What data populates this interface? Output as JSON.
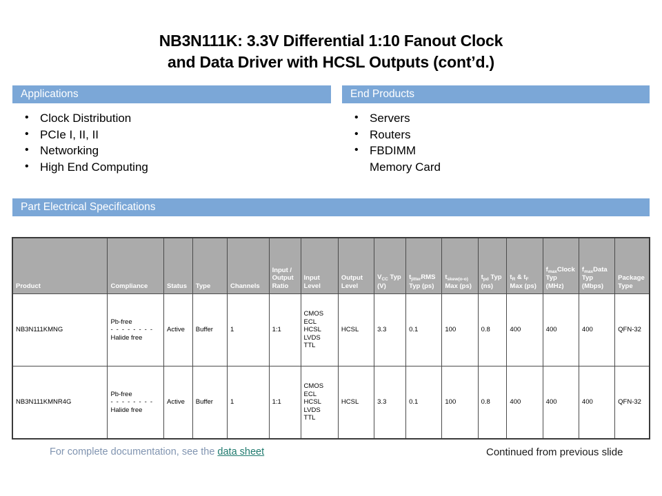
{
  "title": {
    "line1": "NB3N111K: 3.3V Differential 1:10 Fanout Clock",
    "line2": "and Data Driver with HCSL Outputs (cont’d.)"
  },
  "colors": {
    "section_bar": "#7BA7D7",
    "table_header": "#ABABAB",
    "link": "#1F7A6E",
    "footer_text": "#8094B0"
  },
  "applications": {
    "heading": "Applications",
    "items": [
      "Clock Distribution",
      "PCIe I, II, II",
      "Networking",
      "High End Computing"
    ]
  },
  "end_products": {
    "heading": "End Products",
    "items": [
      "Servers",
      "Routers",
      "FBDIMM"
    ],
    "subline": "Memory Card"
  },
  "specs": {
    "heading": "Part Electrical Specifications",
    "columns": [
      {
        "label": "Product",
        "sub": ""
      },
      {
        "label": "Compliance",
        "sub": ""
      },
      {
        "label": "Status",
        "sub": ""
      },
      {
        "label": "Type",
        "sub": ""
      },
      {
        "label": "Channels",
        "sub": ""
      },
      {
        "label": "Input / Output Ratio",
        "sub": ""
      },
      {
        "label": "Input Level",
        "sub": ""
      },
      {
        "label": "Output Level",
        "sub": ""
      },
      {
        "label": "V",
        "sub": "CC",
        "label2": " Typ (V)"
      },
      {
        "label": "t",
        "sub": "jitter",
        "label2": "RMS Typ (ps)"
      },
      {
        "label": "t",
        "sub": "skew(o-o)",
        "label2": " Max (ps)"
      },
      {
        "label": "t",
        "sub": "pd",
        "label2": " Typ (ns)"
      },
      {
        "label": "t",
        "sub": "R",
        "label2": " & t",
        "sub2": "F",
        "label3": " Max (ps)"
      },
      {
        "label": "f",
        "sub": "max",
        "label2": "Clock Typ (MHz)"
      },
      {
        "label": "f",
        "sub": "max",
        "label2": "Data Typ (Mbps)"
      },
      {
        "label": "Package Type",
        "sub": ""
      }
    ],
    "rows": [
      {
        "product": "NB3N111KMNG",
        "compliance_line1": "Pb-free",
        "compliance_line2": "- - - - - - - -",
        "compliance_line3": "Halide  free",
        "status": "Active",
        "type": "Buffer",
        "channels": "1",
        "io_ratio": "1:1",
        "input_level": "CMOS\nECL\nHCSL\nLVDS\nTTL",
        "output_level": "HCSL",
        "vcc_typ": "3.3",
        "tjitter_rms_typ": "0.1",
        "tskew_max": "100",
        "tpd_typ": "0.8",
        "trtf_max": "400",
        "fmax_clock_typ": "400",
        "fmax_data_typ": "400",
        "package_type": "QFN-32"
      },
      {
        "product": "NB3N111KMNR4G",
        "compliance_line1": "Pb-free",
        "compliance_line2": "- - - - - - - -",
        "compliance_line3": "Halide  free",
        "status": "Active",
        "type": "Buffer",
        "channels": "1",
        "io_ratio": "1:1",
        "input_level": "CMOS\nECL\nHCSL\nLVDS\nTTL",
        "output_level": "HCSL",
        "vcc_typ": "3.3",
        "tjitter_rms_typ": "0.1",
        "tskew_max": "100",
        "tpd_typ": "0.8",
        "trtf_max": "400",
        "fmax_clock_typ": "400",
        "fmax_data_typ": "400",
        "package_type": "QFN-32"
      }
    ]
  },
  "footer": {
    "left_prefix": "For complete documentation,  see the ",
    "left_link": "data sheet",
    "right": "Continued  from previous slide"
  }
}
